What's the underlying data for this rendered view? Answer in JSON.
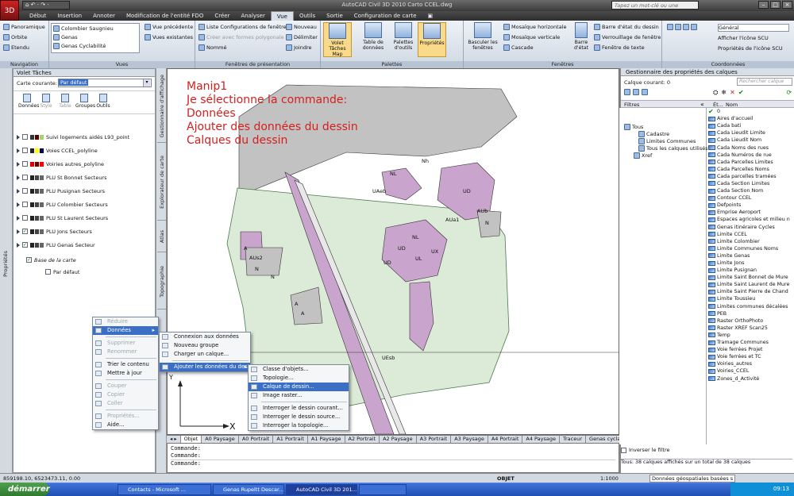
{
  "window": {
    "app_button": "3D",
    "title": "AutoCAD Civil 3D 2010    Carto CCEL.dwg",
    "search_placeholder": "Tapez un mot-clé ou une expressi",
    "qat": "⌂ ↶ · ↷ ·"
  },
  "menubar": [
    "Début",
    "Insertion",
    "Annoter",
    "Modification de l'entité FDO",
    "Créer",
    "Analyser",
    "Vue",
    "Outils",
    "Sortie",
    "Configuration de carte",
    "▣"
  ],
  "menubar_active": "Vue",
  "ribbon": {
    "navigation": {
      "title": "Navigation",
      "items": [
        "Panoramique",
        "Orbite",
        "Etendu"
      ]
    },
    "vues": {
      "title": "Vues",
      "list": [
        "Colombier Saugnieu",
        "Genas",
        "Genas Cyclabilité"
      ],
      "items": [
        "Vue précédente",
        "Vues existantes"
      ]
    },
    "fenetres": {
      "title": "Fenêtres de présentation",
      "items": [
        "Liste Configurations de fenêtre",
        "Créer avec formes polygonale",
        "Nommé",
        "Nouveau",
        "Délimiter",
        "Joindre"
      ]
    },
    "palettes": {
      "title": "Palettes",
      "buttons": [
        "Volet Tâches Map",
        "Table de données",
        "Palettes d'outils",
        "Propriétés"
      ]
    },
    "fenetres2": {
      "title": "Fenêtres",
      "items": [
        "Basculer les fenêtres",
        "Mosaïque horizontale",
        "Mosaïque verticale",
        "Cascade",
        "Barre d'état",
        "Barre d'état du dessin",
        "Verrouillage de fenêtre",
        "Fenêtre de texte"
      ]
    },
    "coordonnees": {
      "title": "Coordonnées",
      "items": [
        "Général",
        "Afficher l'icône SCU",
        "Propriétés de l'icône SCU"
      ]
    }
  },
  "left_strip_label": "Propriétés",
  "taskpane": {
    "title": "Volet Tâches",
    "map_label": "Carte courante:",
    "map_value": "Par défaut",
    "tools": [
      "Données",
      "Style",
      "Table",
      "Groupes",
      "Outils"
    ],
    "layers": [
      {
        "name": "Suivi logements aidés L93_point",
        "checked": false
      },
      {
        "name": "Voies CCEL_polyline",
        "checked": false
      },
      {
        "name": "Voiries autres_polyline",
        "checked": false
      },
      {
        "name": "PLU St Bonnet Secteurs",
        "checked": false
      },
      {
        "name": "PLU Pusignan Secteurs",
        "checked": false
      },
      {
        "name": "PLU Colombier Secteurs",
        "checked": false
      },
      {
        "name": "PLU St Laurent Secteurs",
        "checked": false
      },
      {
        "name": "PLU Jons Secteurs",
        "checked": true
      },
      {
        "name": "PLU Genas Secteur",
        "checked": true
      }
    ],
    "base": "Base de la carte",
    "default": "Par défaut"
  },
  "vtabs": [
    "Gestionnaire d'affichage",
    "Explorateur de carte",
    "Atlas",
    "Topographie"
  ],
  "drawing": {
    "annotation": [
      "Manip1",
      "Je sélectionne la commande:",
      "Données",
      "Ajouter des données du dessin",
      "Calques du dessin"
    ],
    "zone_labels": [
      "Nh",
      "NL",
      "UD",
      "AUb",
      "AUa1",
      "UAeb",
      "NL",
      "UD",
      "UX",
      "N",
      "UD",
      "A",
      "AUs2",
      "N",
      "A",
      "A",
      "N",
      "UEsb",
      "UL"
    ],
    "ucs_x": "X",
    "ucs_y": "Y"
  },
  "layout_tabs": [
    "Objet",
    "A0 Paysage",
    "A0 Portrait",
    "A1 Portrait",
    "A1 Paysage",
    "A2 Portrait",
    "A2 Paysage",
    "A3 Portrait",
    "A3 Paysage",
    "A4 Portrait",
    "A4 Paysage",
    "Traceur",
    "Genas cyclabilité"
  ],
  "command_lines": [
    "Commande:",
    "Commande:",
    "Commande:"
  ],
  "context_menu": {
    "items": [
      {
        "label": "Réduire",
        "disabled": true
      },
      {
        "label": "Données",
        "highlight": true,
        "submenu": true
      },
      {
        "label": "Supprimer",
        "disabled": true
      },
      {
        "label": "Renommer",
        "disabled": true
      },
      {
        "label": "Trier le contenu"
      },
      {
        "label": "Mettre à jour"
      },
      {
        "label": "Couper",
        "disabled": true
      },
      {
        "label": "Copier",
        "disabled": true
      },
      {
        "label": "Coller",
        "disabled": true
      },
      {
        "label": "Propriétés...",
        "disabled": true
      },
      {
        "label": "Aide..."
      }
    ]
  },
  "submenu1": [
    "Connexion aux données",
    "Nouveau groupe",
    "Charger un calque...",
    "Ajouter les données du dessin"
  ],
  "submenu2": [
    "Classe d'objets...",
    "Topologie...",
    "Calque de dessin...",
    "Image raster...",
    "Interroger le dessin courant...",
    "Interroger le dessin source...",
    "Interroger la topologie..."
  ],
  "right_pane": {
    "title": "Gestionnaire des propriétés des calques",
    "current": "Calque courant: 0",
    "search_placeholder": "Rechercher calque",
    "filters_header": "Filtres",
    "tree": [
      "Tous",
      "Cadastre",
      "Limites Communes",
      "Tous les calques utilisés",
      "Xref"
    ],
    "col_status": "Ét...",
    "col_name": "Nom",
    "layers": [
      "0",
      "Aires d'accueil",
      "Cada bati",
      "Cada Lieudit Limite",
      "Cada Lieudit Nom",
      "Cada Noms des rues",
      "Cada Numéros de rue",
      "Cada Parcelles Limites",
      "Cada Parcelles Noms",
      "Cada parcelles tramées",
      "Cada Section Limites",
      "Cada Section Nom",
      "Contour CCEL",
      "Defpoints",
      "Emprise Aeroport",
      "Espaces agricoles et milieu n",
      "Genas itinéraire Cycles",
      "Limite CCEL",
      "Limite Colombier",
      "Limite Communes Noms",
      "Limite Genas",
      "Limite Jons",
      "Limite Pusignan",
      "Limite Saint Bonnet de Mure",
      "Limite Saint Laurent de Mure",
      "Limite Saint Pierre de Chand",
      "Limite Toussieu",
      "Limites communes décalées",
      "PEB",
      "Raster OrthoPhoto",
      "Raster XREF Scan25",
      "Temp",
      "Tramage Communes",
      "Voie ferrées Projet",
      "Voie ferrées et TC",
      "Voiries_autres",
      "Voiries_CCEL",
      "Zones_d_Activité"
    ],
    "invert_filter": "Inverser le filtre",
    "footer": "Tous: 38 calques affichés sur un total de 38 calques"
  },
  "status": {
    "coords": "859198.10, 6523473.11, 0.00",
    "objet": "OBJET",
    "scale": "1:1000",
    "geo": "Données géospatiales basées s"
  },
  "taskbar": {
    "start": "démarrer",
    "buttons": [
      "Contacts - Microsoft ...",
      "Genas Rupeltt Descar...",
      "AutoCAD Civil 3D 201...",
      ""
    ],
    "time": "09:13"
  },
  "colors": {
    "zone_fill": "#dcebd7",
    "zone_stroke": "#4a7a4a",
    "urban_fill": "#c9a4cc",
    "grey_fill": "#c2c2c2",
    "annot": "#d42020"
  }
}
